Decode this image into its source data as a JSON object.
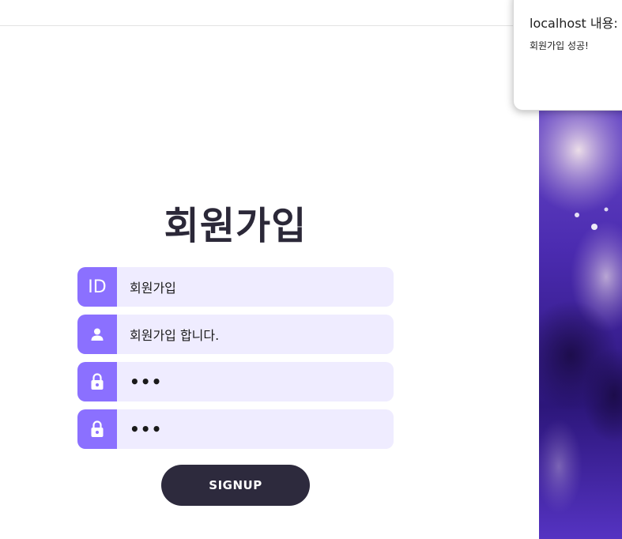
{
  "page": {
    "title": "회원가입"
  },
  "form": {
    "id_prefix": "ID",
    "id_value": "회원가입",
    "name_value": "회원가입 합니다.",
    "password_value": "•••",
    "password_confirm_value": "•••",
    "submit_label": "SIGNUP"
  },
  "alert": {
    "title": "localhost 내용:",
    "message": "회원가입 성공!"
  },
  "colors": {
    "accent": "#8b70ff",
    "field_bg": "#efecff",
    "button_bg": "#2d2a3d",
    "title_text": "#2b2838"
  },
  "icons": {
    "name_field": "user-icon",
    "password_field": "lock-icon",
    "password_confirm_field": "lock-icon"
  }
}
